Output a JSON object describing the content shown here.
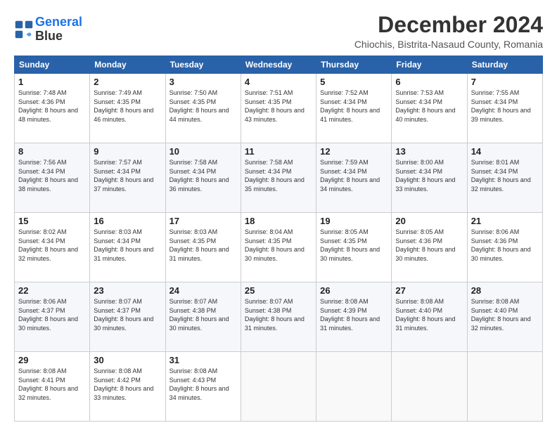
{
  "logo": {
    "line1": "General",
    "line2": "Blue"
  },
  "title": "December 2024",
  "location": "Chiochis, Bistrita-Nasaud County, Romania",
  "days_header": [
    "Sunday",
    "Monday",
    "Tuesday",
    "Wednesday",
    "Thursday",
    "Friday",
    "Saturday"
  ],
  "weeks": [
    [
      {
        "day": "1",
        "sunrise": "Sunrise: 7:48 AM",
        "sunset": "Sunset: 4:36 PM",
        "daylight": "Daylight: 8 hours and 48 minutes."
      },
      {
        "day": "2",
        "sunrise": "Sunrise: 7:49 AM",
        "sunset": "Sunset: 4:35 PM",
        "daylight": "Daylight: 8 hours and 46 minutes."
      },
      {
        "day": "3",
        "sunrise": "Sunrise: 7:50 AM",
        "sunset": "Sunset: 4:35 PM",
        "daylight": "Daylight: 8 hours and 44 minutes."
      },
      {
        "day": "4",
        "sunrise": "Sunrise: 7:51 AM",
        "sunset": "Sunset: 4:35 PM",
        "daylight": "Daylight: 8 hours and 43 minutes."
      },
      {
        "day": "5",
        "sunrise": "Sunrise: 7:52 AM",
        "sunset": "Sunset: 4:34 PM",
        "daylight": "Daylight: 8 hours and 41 minutes."
      },
      {
        "day": "6",
        "sunrise": "Sunrise: 7:53 AM",
        "sunset": "Sunset: 4:34 PM",
        "daylight": "Daylight: 8 hours and 40 minutes."
      },
      {
        "day": "7",
        "sunrise": "Sunrise: 7:55 AM",
        "sunset": "Sunset: 4:34 PM",
        "daylight": "Daylight: 8 hours and 39 minutes."
      }
    ],
    [
      {
        "day": "8",
        "sunrise": "Sunrise: 7:56 AM",
        "sunset": "Sunset: 4:34 PM",
        "daylight": "Daylight: 8 hours and 38 minutes."
      },
      {
        "day": "9",
        "sunrise": "Sunrise: 7:57 AM",
        "sunset": "Sunset: 4:34 PM",
        "daylight": "Daylight: 8 hours and 37 minutes."
      },
      {
        "day": "10",
        "sunrise": "Sunrise: 7:58 AM",
        "sunset": "Sunset: 4:34 PM",
        "daylight": "Daylight: 8 hours and 36 minutes."
      },
      {
        "day": "11",
        "sunrise": "Sunrise: 7:58 AM",
        "sunset": "Sunset: 4:34 PM",
        "daylight": "Daylight: 8 hours and 35 minutes."
      },
      {
        "day": "12",
        "sunrise": "Sunrise: 7:59 AM",
        "sunset": "Sunset: 4:34 PM",
        "daylight": "Daylight: 8 hours and 34 minutes."
      },
      {
        "day": "13",
        "sunrise": "Sunrise: 8:00 AM",
        "sunset": "Sunset: 4:34 PM",
        "daylight": "Daylight: 8 hours and 33 minutes."
      },
      {
        "day": "14",
        "sunrise": "Sunrise: 8:01 AM",
        "sunset": "Sunset: 4:34 PM",
        "daylight": "Daylight: 8 hours and 32 minutes."
      }
    ],
    [
      {
        "day": "15",
        "sunrise": "Sunrise: 8:02 AM",
        "sunset": "Sunset: 4:34 PM",
        "daylight": "Daylight: 8 hours and 32 minutes."
      },
      {
        "day": "16",
        "sunrise": "Sunrise: 8:03 AM",
        "sunset": "Sunset: 4:34 PM",
        "daylight": "Daylight: 8 hours and 31 minutes."
      },
      {
        "day": "17",
        "sunrise": "Sunrise: 8:03 AM",
        "sunset": "Sunset: 4:35 PM",
        "daylight": "Daylight: 8 hours and 31 minutes."
      },
      {
        "day": "18",
        "sunrise": "Sunrise: 8:04 AM",
        "sunset": "Sunset: 4:35 PM",
        "daylight": "Daylight: 8 hours and 30 minutes."
      },
      {
        "day": "19",
        "sunrise": "Sunrise: 8:05 AM",
        "sunset": "Sunset: 4:35 PM",
        "daylight": "Daylight: 8 hours and 30 minutes."
      },
      {
        "day": "20",
        "sunrise": "Sunrise: 8:05 AM",
        "sunset": "Sunset: 4:36 PM",
        "daylight": "Daylight: 8 hours and 30 minutes."
      },
      {
        "day": "21",
        "sunrise": "Sunrise: 8:06 AM",
        "sunset": "Sunset: 4:36 PM",
        "daylight": "Daylight: 8 hours and 30 minutes."
      }
    ],
    [
      {
        "day": "22",
        "sunrise": "Sunrise: 8:06 AM",
        "sunset": "Sunset: 4:37 PM",
        "daylight": "Daylight: 8 hours and 30 minutes."
      },
      {
        "day": "23",
        "sunrise": "Sunrise: 8:07 AM",
        "sunset": "Sunset: 4:37 PM",
        "daylight": "Daylight: 8 hours and 30 minutes."
      },
      {
        "day": "24",
        "sunrise": "Sunrise: 8:07 AM",
        "sunset": "Sunset: 4:38 PM",
        "daylight": "Daylight: 8 hours and 30 minutes."
      },
      {
        "day": "25",
        "sunrise": "Sunrise: 8:07 AM",
        "sunset": "Sunset: 4:38 PM",
        "daylight": "Daylight: 8 hours and 31 minutes."
      },
      {
        "day": "26",
        "sunrise": "Sunrise: 8:08 AM",
        "sunset": "Sunset: 4:39 PM",
        "daylight": "Daylight: 8 hours and 31 minutes."
      },
      {
        "day": "27",
        "sunrise": "Sunrise: 8:08 AM",
        "sunset": "Sunset: 4:40 PM",
        "daylight": "Daylight: 8 hours and 31 minutes."
      },
      {
        "day": "28",
        "sunrise": "Sunrise: 8:08 AM",
        "sunset": "Sunset: 4:40 PM",
        "daylight": "Daylight: 8 hours and 32 minutes."
      }
    ],
    [
      {
        "day": "29",
        "sunrise": "Sunrise: 8:08 AM",
        "sunset": "Sunset: 4:41 PM",
        "daylight": "Daylight: 8 hours and 32 minutes."
      },
      {
        "day": "30",
        "sunrise": "Sunrise: 8:08 AM",
        "sunset": "Sunset: 4:42 PM",
        "daylight": "Daylight: 8 hours and 33 minutes."
      },
      {
        "day": "31",
        "sunrise": "Sunrise: 8:08 AM",
        "sunset": "Sunset: 4:43 PM",
        "daylight": "Daylight: 8 hours and 34 minutes."
      },
      null,
      null,
      null,
      null
    ]
  ]
}
